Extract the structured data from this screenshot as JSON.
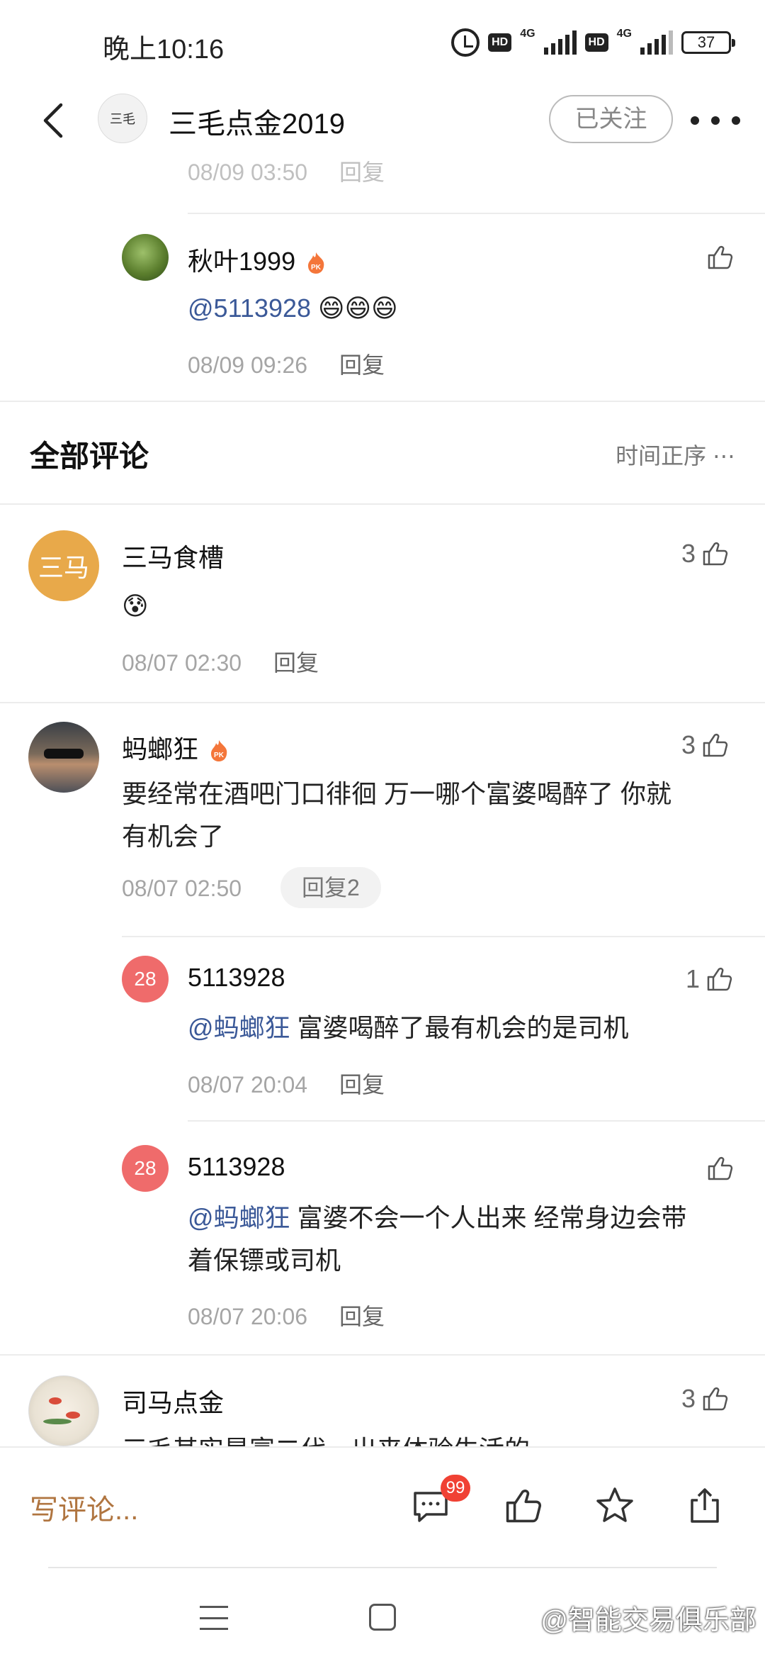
{
  "status": {
    "time": "晚上10:16",
    "net1": "4G",
    "net2": "4G",
    "battery": "37"
  },
  "header": {
    "title": "三毛点金2019",
    "avatar_text": "三毛",
    "follow_label": "已关注"
  },
  "top_thread": {
    "partial_meta_time": "08/09 03:50",
    "partial_meta_reply": "回复",
    "reply": {
      "name": "秋叶1999",
      "mention": "@5113928",
      "emojis": "😄😄😄",
      "time": "08/09 09:26",
      "reply_label": "回复"
    }
  },
  "section": {
    "title": "全部评论",
    "sort_label": "时间正序 ⋯"
  },
  "comments": [
    {
      "name": "三马食槽",
      "avatar_text": "三马",
      "avatar_color": "#e8a94a",
      "likes": "3",
      "content": "😰",
      "time": "08/07 02:30",
      "reply_label": "回复"
    },
    {
      "name": "蚂螂狂",
      "likes": "3",
      "content_line1": "要经常在酒吧门口徘徊 万一哪个富婆喝醉了 你就",
      "content_line2": "有机会了",
      "time": "08/07 02:50",
      "reply_label": "回复2",
      "replies": [
        {
          "name": "5113928",
          "avatar_text": "28",
          "avatar_color": "#ef6b6b",
          "likes": "1",
          "mention": "@蚂螂狂",
          "content": " 富婆喝醉了最有机会的是司机",
          "time": "08/07 20:04",
          "reply_label": "回复"
        },
        {
          "name": "5113928",
          "avatar_text": "28",
          "avatar_color": "#ef6b6b",
          "likes": "",
          "mention": "@蚂螂狂",
          "content_line1": " 富婆不会一个人出来 经常身边会带",
          "content_line2": "着保镖或司机",
          "time": "08/07 20:06",
          "reply_label": "回复"
        }
      ]
    },
    {
      "name": "司马点金",
      "likes": "3",
      "content_partial": "三毛其实是富二代，出来体验生活的"
    }
  ],
  "bottom": {
    "write_comment": "写评论...",
    "comment_count": "99"
  },
  "watermark": "@智能交易俱乐部"
}
